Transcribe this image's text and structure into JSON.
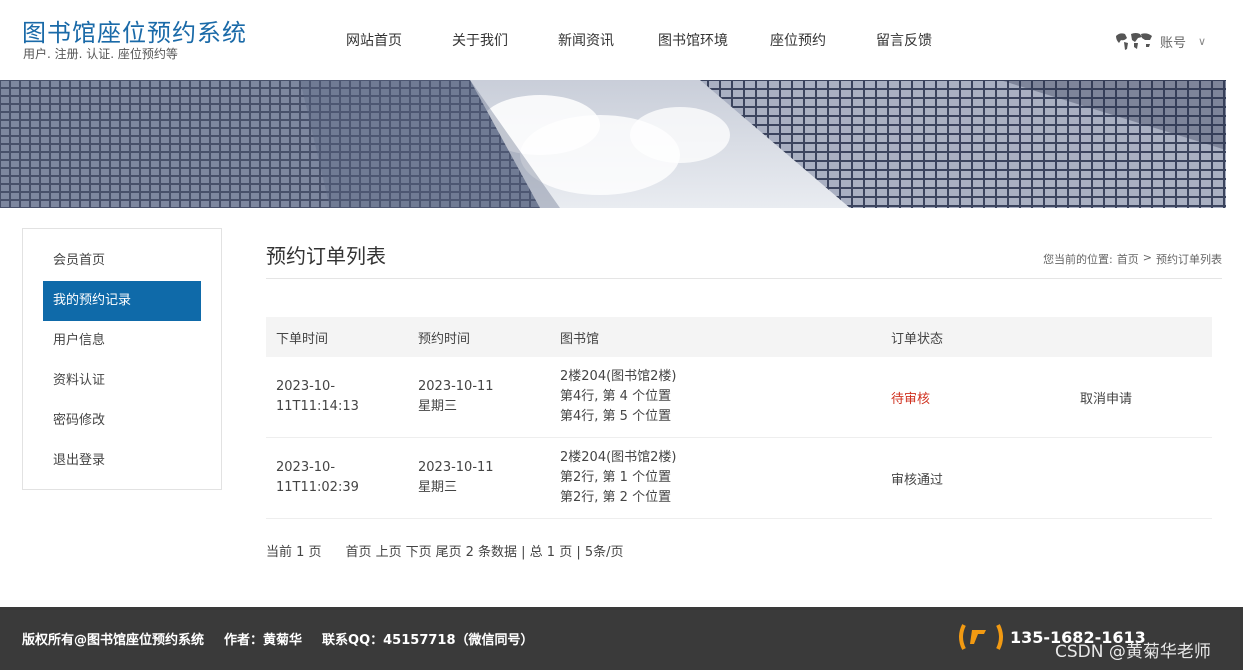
{
  "header": {
    "title": "图书馆座位预约系统",
    "subtitle": "用户. 注册. 认证. 座位预约等",
    "nav": [
      "网站首页",
      "关于我们",
      "新闻资讯",
      "图书馆环境",
      "座位预约",
      "留言反馈"
    ],
    "account_label": "账号",
    "account_icon": "world-map-icon"
  },
  "sidebar": {
    "items": [
      {
        "label": "会员首页",
        "active": false
      },
      {
        "label": "我的预约记录",
        "active": true
      },
      {
        "label": "用户信息",
        "active": false
      },
      {
        "label": "资料认证",
        "active": false
      },
      {
        "label": "密码修改",
        "active": false
      },
      {
        "label": "退出登录",
        "active": false
      }
    ],
    "active_color": "#0f6aa9"
  },
  "main": {
    "title": "预约订单列表",
    "breadcrumb": {
      "prefix": "您当前的位置:",
      "home": "首页",
      "sep": ">",
      "current": "预约订单列表"
    },
    "table": {
      "headers": [
        "下单时间",
        "预约时间",
        "图书馆",
        "订单状态",
        ""
      ],
      "rows": [
        {
          "order_time": [
            "2023-10-",
            "11T11:14:13"
          ],
          "reserve_time": [
            "2023-10-11",
            "星期三"
          ],
          "library": [
            "2楼204(图书馆2楼)",
            "第4行, 第 4 个位置",
            "第4行, 第 5 个位置"
          ],
          "status": "待审核",
          "action": "取消申请"
        },
        {
          "order_time": [
            "2023-10-",
            "11T11:02:39"
          ],
          "reserve_time": [
            "2023-10-11",
            "星期三"
          ],
          "library": [
            "2楼204(图书馆2楼)",
            "第2行, 第 1 个位置",
            "第2行, 第 2 个位置"
          ],
          "status": "审核通过",
          "action": ""
        }
      ],
      "pending_color": "#d0311f"
    },
    "pager": {
      "current": "当前 1 页",
      "first": "首页",
      "prev": "上页",
      "next": "下页",
      "last": "尾页",
      "summary": "2 条数据 | 总 1 页 | 5条/页"
    }
  },
  "footer": {
    "copyright": "版权所有@图书馆座位预约系统",
    "author": "作者：黄菊华",
    "contact": "联系QQ：45157718（微信同号）",
    "phone": "135-1682-1613",
    "phone_icon": "phone-icon",
    "watermark": "CSDN @黄菊华老师",
    "accent": "#f29a12"
  }
}
